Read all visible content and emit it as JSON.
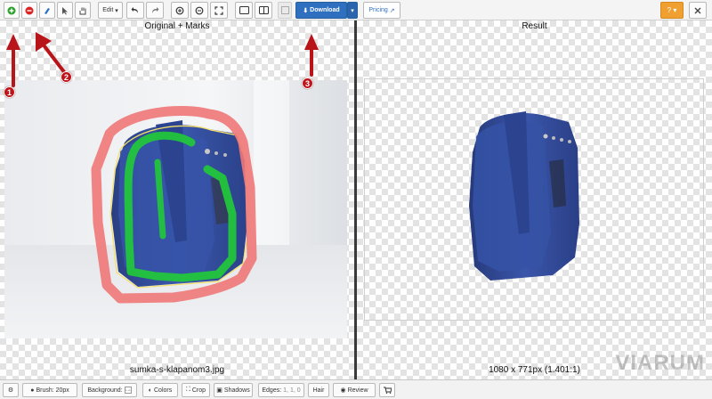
{
  "toolbar": {
    "green_button": "green-marker-tool",
    "red_button": "red-marker-tool",
    "edit_label": "Edit",
    "download_label": "Download",
    "pricing_label": "Pricing",
    "help_label": "?"
  },
  "left_pane": {
    "title": "Original + Marks",
    "filename": "sumka-s-klapanom3.jpg"
  },
  "right_pane": {
    "title": "Result",
    "dimensions": "1080 x 771px (1.401:1)"
  },
  "annotations": {
    "badge_1": "1",
    "badge_2": "2",
    "badge_3": "3"
  },
  "watermark": "VIARUM",
  "bottombar": {
    "brush_label": "Brush: 20px",
    "background_label": "Background:",
    "colors_label": "Colors",
    "crop_label": "Crop",
    "shadows_label": "Shadows",
    "edges_label": "Edges:",
    "edges_value": "1, 1, 0",
    "hair_label": "Hair",
    "review_label": "Review"
  },
  "colors": {
    "accent": "#2f6fc0",
    "help": "#f0a030",
    "keep_mark": "#2ecc40",
    "remove_mark": "#f07070",
    "annotation": "#c0141a",
    "bag": "#3450a0"
  }
}
